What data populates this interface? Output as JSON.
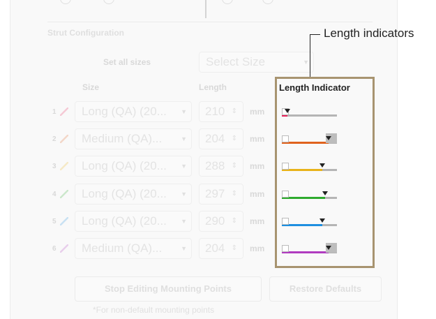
{
  "config": {
    "section_title": "Strut Configuration",
    "set_all_label": "Set all sizes",
    "set_all_placeholder": "Select Size",
    "headers": {
      "size": "Size",
      "length": "Length",
      "indicator": "Length Indicator"
    },
    "unit": "mm",
    "struts": [
      {
        "num": "1",
        "size": "Long (QA) (20...",
        "length": "210",
        "color": "#e8245a",
        "fraction": 0.1
      },
      {
        "num": "2",
        "size": "Medium (QA)...",
        "length": "204",
        "color": "#e0631e",
        "fraction": 0.85
      },
      {
        "num": "3",
        "size": "Long (QA) (20...",
        "length": "288",
        "color": "#e8b31a",
        "fraction": 0.73
      },
      {
        "num": "4",
        "size": "Long (QA) (20...",
        "length": "297",
        "color": "#2eab2e",
        "fraction": 0.78
      },
      {
        "num": "5",
        "size": "Long (QA) (20...",
        "length": "290",
        "color": "#1e8fe0",
        "fraction": 0.73
      },
      {
        "num": "6",
        "size": "Medium (QA)...",
        "length": "204",
        "color": "#b03cc0",
        "fraction": 0.85
      }
    ],
    "stop_editing_label": "Stop Editing Mounting Points",
    "restore_label": "Restore Defaults",
    "note": "*For non-default mounting points"
  },
  "callout": {
    "label": "Length indicators"
  }
}
